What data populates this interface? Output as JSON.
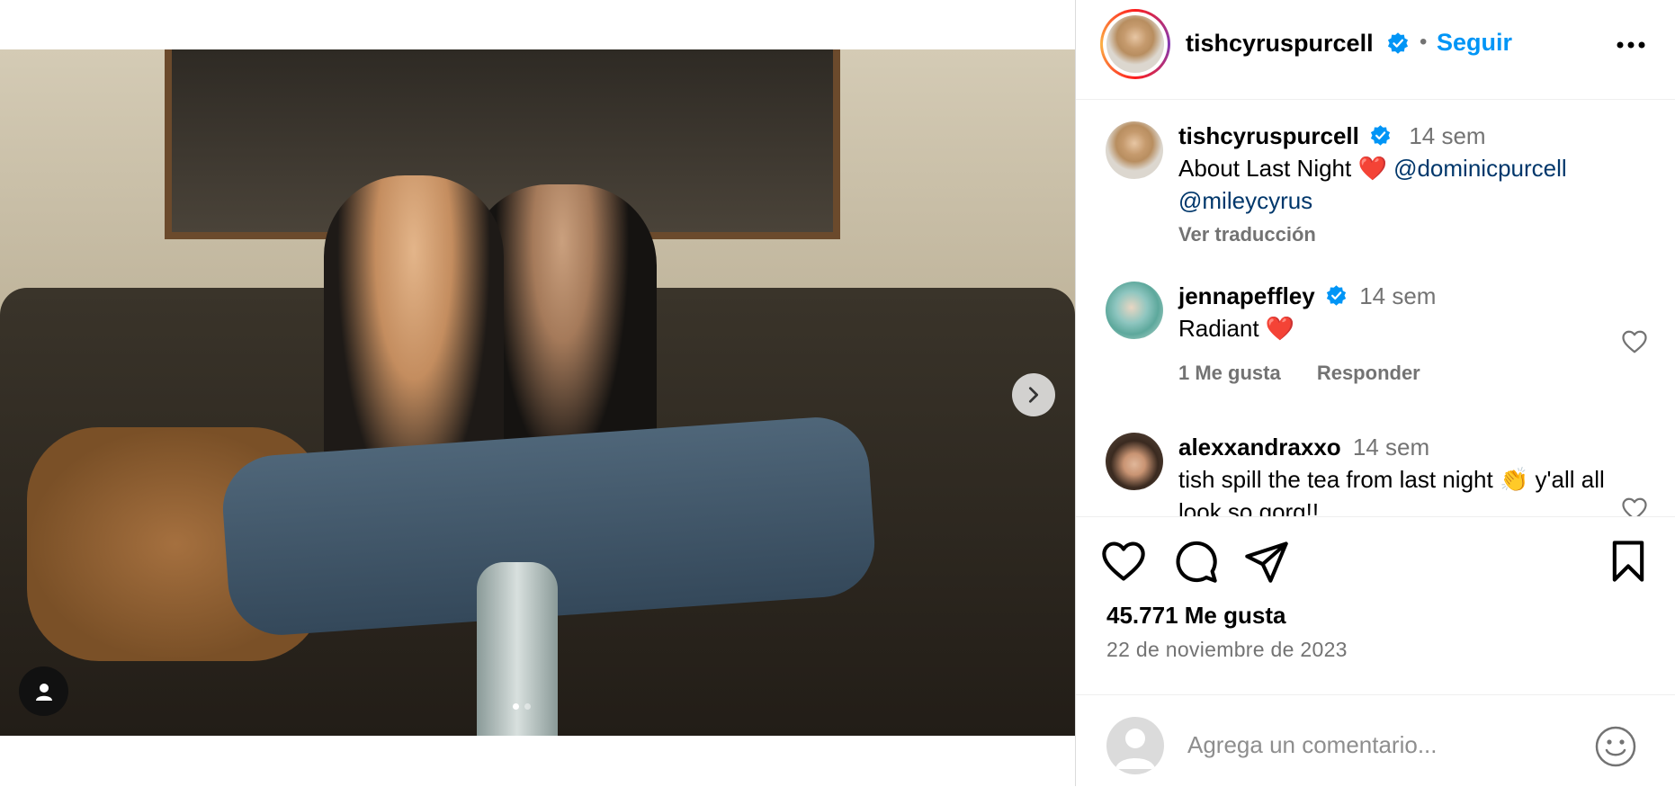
{
  "post": {
    "image_alt": "Foto: dos personas sentadas en un sofá",
    "carousel": {
      "total": 2,
      "active": 0
    }
  },
  "header": {
    "username": "tishcyruspurcell",
    "separator": "•",
    "follow_label": "Seguir",
    "more_icon": "more-horizontal-icon"
  },
  "caption": {
    "username": "tishcyruspurcell",
    "time": "14 sem",
    "text": "About Last Night ❤️",
    "mention1": "@dominicpurcell",
    "mention2": "@mileycyrus",
    "translate_label": "Ver traducción"
  },
  "comments": [
    {
      "username": "jennapeffley",
      "verified": true,
      "time": "14 sem",
      "text": "Radiant ❤️",
      "likes_label": "1 Me gusta",
      "reply_label": "Responder"
    },
    {
      "username": "alexxandraxxo",
      "verified": false,
      "time": "14 sem",
      "text": "tish spill the tea from last night 👏 y'all all look so gorg!!"
    }
  ],
  "stats": {
    "likes": "45.771 Me gusta",
    "date": "22 de noviembre de 2023"
  },
  "composer": {
    "placeholder": "Agrega un comentario..."
  },
  "colors": {
    "accent": "#0095f6",
    "verified": "#0095f6",
    "mention": "#00376b",
    "secondary_text": "#737373"
  }
}
